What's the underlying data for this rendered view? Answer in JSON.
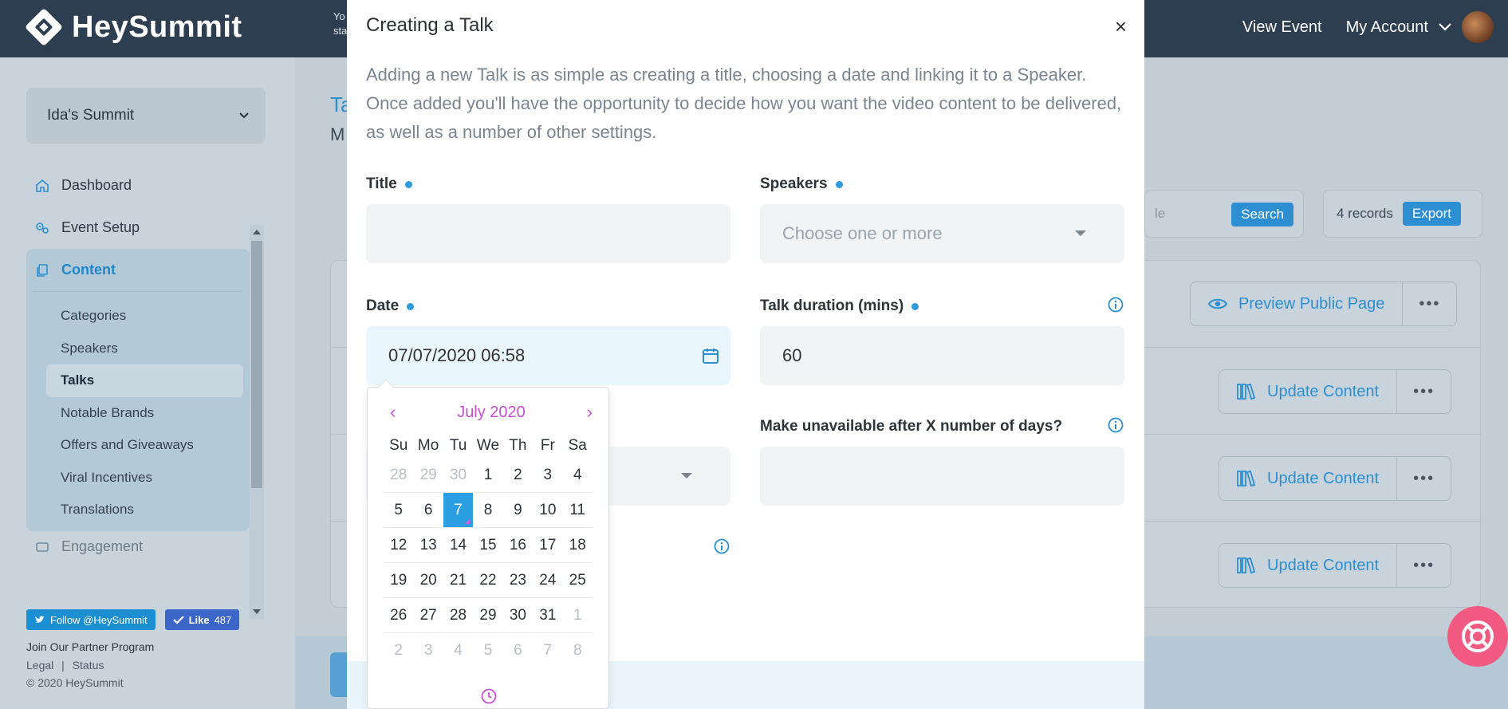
{
  "topbar": {
    "logo_text": "HeySummit",
    "hint_line1": "Yo",
    "hint_line2": "sta",
    "view_event": "View Event",
    "my_account": "My Account"
  },
  "sidebar": {
    "summit_name": "Ida's Summit",
    "nav": {
      "dashboard": "Dashboard",
      "event_setup": "Event Setup",
      "content": "Content",
      "engagement": "Engagement"
    },
    "content_items": [
      "Categories",
      "Speakers",
      "Talks",
      "Notable Brands",
      "Offers and Giveaways",
      "Viral Incentives",
      "Translations"
    ],
    "footer": {
      "twitter": "Follow @HeySummit",
      "like": "Like",
      "like_count": "487",
      "partner": "Join Our Partner Program",
      "legal": "Legal",
      "sep": "|",
      "status": "Status",
      "copyright": "© 2020 HeySummit"
    }
  },
  "main": {
    "title_fragment": "Ta",
    "subtitle_fragment": "M",
    "search_ghost": "le",
    "search_button": "Search",
    "records": "4 records",
    "export": "Export",
    "rows": [
      {
        "action": "Preview Public Page"
      },
      {
        "action": "Update Content"
      },
      {
        "action": "Update Content"
      },
      {
        "action": "Update Content"
      }
    ]
  },
  "modal": {
    "title": "Creating a Talk",
    "close": "×",
    "description": "Adding a new Talk is as simple as creating a title, choosing a date and linking it to a Speaker. Once added you'll have the opportunity to decide how you want the video content to be delivered, as well as a number of other settings.",
    "title_label": "Title",
    "title_value": "",
    "speakers_label": "Speakers",
    "speakers_placeholder": "Choose one or more",
    "date_label": "Date",
    "date_value": "07/07/2020 06:58",
    "duration_label": "Talk duration (mins)",
    "duration_value": "60",
    "unavailable_label": "Make unavailable after X number of days?",
    "unavailable_value": ""
  },
  "datepicker": {
    "prev": "‹",
    "next": "›",
    "month_label": "July 2020",
    "weekdays": [
      "Su",
      "Mo",
      "Tu",
      "We",
      "Th",
      "Fr",
      "Sa"
    ],
    "selected_day": "7",
    "weeks": [
      [
        {
          "d": "28",
          "m": true
        },
        {
          "d": "29",
          "m": true
        },
        {
          "d": "30",
          "m": true
        },
        {
          "d": "1"
        },
        {
          "d": "2"
        },
        {
          "d": "3"
        },
        {
          "d": "4"
        }
      ],
      [
        {
          "d": "5"
        },
        {
          "d": "6"
        },
        {
          "d": "7",
          "sel": true
        },
        {
          "d": "8"
        },
        {
          "d": "9"
        },
        {
          "d": "10"
        },
        {
          "d": "11"
        }
      ],
      [
        {
          "d": "12"
        },
        {
          "d": "13"
        },
        {
          "d": "14"
        },
        {
          "d": "15"
        },
        {
          "d": "16"
        },
        {
          "d": "17"
        },
        {
          "d": "18"
        }
      ],
      [
        {
          "d": "19"
        },
        {
          "d": "20"
        },
        {
          "d": "21"
        },
        {
          "d": "22"
        },
        {
          "d": "23"
        },
        {
          "d": "24"
        },
        {
          "d": "25"
        }
      ],
      [
        {
          "d": "26"
        },
        {
          "d": "27"
        },
        {
          "d": "28"
        },
        {
          "d": "29"
        },
        {
          "d": "30"
        },
        {
          "d": "31"
        },
        {
          "d": "1",
          "m": true
        }
      ],
      [
        {
          "d": "2",
          "m": true
        },
        {
          "d": "3",
          "m": true
        },
        {
          "d": "4",
          "m": true
        },
        {
          "d": "5",
          "m": true
        },
        {
          "d": "6",
          "m": true
        },
        {
          "d": "7",
          "m": true
        },
        {
          "d": "8",
          "m": true
        }
      ]
    ]
  },
  "colors": {
    "topbar": "#2c3e50",
    "accent": "#2d8fd1",
    "datepicker_accent": "#c44fd1",
    "help_bubble": "#f25a82"
  }
}
